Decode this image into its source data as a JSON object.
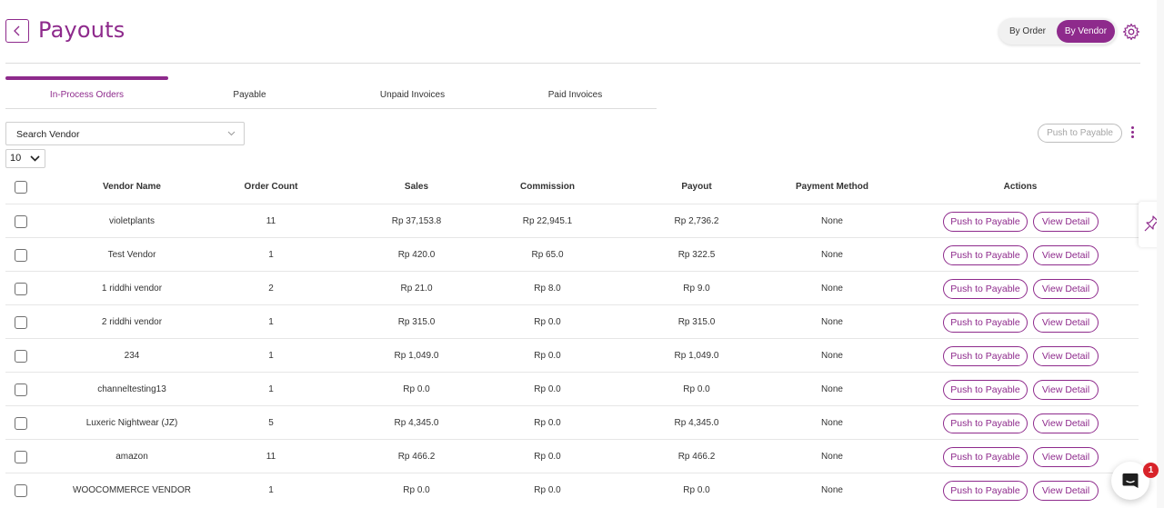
{
  "header": {
    "title": "Payouts",
    "toggle_by_order": "By Order",
    "toggle_by_vendor": "By Vendor",
    "selected_view": "By Vendor"
  },
  "tabs": [
    {
      "label": "In-Process Orders",
      "active": true
    },
    {
      "label": "Payable",
      "active": false
    },
    {
      "label": "Unpaid Invoices",
      "active": false
    },
    {
      "label": "Paid Invoices",
      "active": false
    }
  ],
  "filters": {
    "search_placeholder": "Search Vendor",
    "page_size": "10"
  },
  "toolbar": {
    "push_to_payable": "Push to Payable"
  },
  "table": {
    "columns": [
      "Vendor Name",
      "Order Count",
      "Sales",
      "Commission",
      "Payout",
      "Payment Method",
      "Actions"
    ],
    "action_push": "Push to Payable",
    "action_view": "View Detail",
    "rows": [
      {
        "vendor": "violetplants",
        "count": "11",
        "sales": "Rp 37,153.8",
        "commission": "Rp 22,945.1",
        "payout": "Rp 2,736.2",
        "method": "None"
      },
      {
        "vendor": "Test Vendor",
        "count": "1",
        "sales": "Rp 420.0",
        "commission": "Rp 65.0",
        "payout": "Rp 322.5",
        "method": "None"
      },
      {
        "vendor": "1 riddhi vendor",
        "count": "2",
        "sales": "Rp 21.0",
        "commission": "Rp 8.0",
        "payout": "Rp 9.0",
        "method": "None"
      },
      {
        "vendor": "2 riddhi vendor",
        "count": "1",
        "sales": "Rp 315.0",
        "commission": "Rp 0.0",
        "payout": "Rp 315.0",
        "method": "None"
      },
      {
        "vendor": "234",
        "count": "1",
        "sales": "Rp 1,049.0",
        "commission": "Rp 0.0",
        "payout": "Rp 1,049.0",
        "method": "None"
      },
      {
        "vendor": "channeltesting13",
        "count": "1",
        "sales": "Rp 0.0",
        "commission": "Rp 0.0",
        "payout": "Rp 0.0",
        "method": "None"
      },
      {
        "vendor": "Luxeric Nightwear (JZ)",
        "count": "5",
        "sales": "Rp 4,345.0",
        "commission": "Rp 0.0",
        "payout": "Rp 4,345.0",
        "method": "None"
      },
      {
        "vendor": "amazon",
        "count": "11",
        "sales": "Rp 466.2",
        "commission": "Rp 0.0",
        "payout": "Rp 466.2",
        "method": "None"
      },
      {
        "vendor": "WOOCOMMERCE VENDOR",
        "count": "1",
        "sales": "Rp 0.0",
        "commission": "Rp 0.0",
        "payout": "Rp 0.0",
        "method": "None"
      }
    ]
  },
  "chat": {
    "badge_count": "1"
  },
  "colors": {
    "accent": "#8e2a8c",
    "badge": "#d8232a",
    "border": "#e6e6e6"
  }
}
